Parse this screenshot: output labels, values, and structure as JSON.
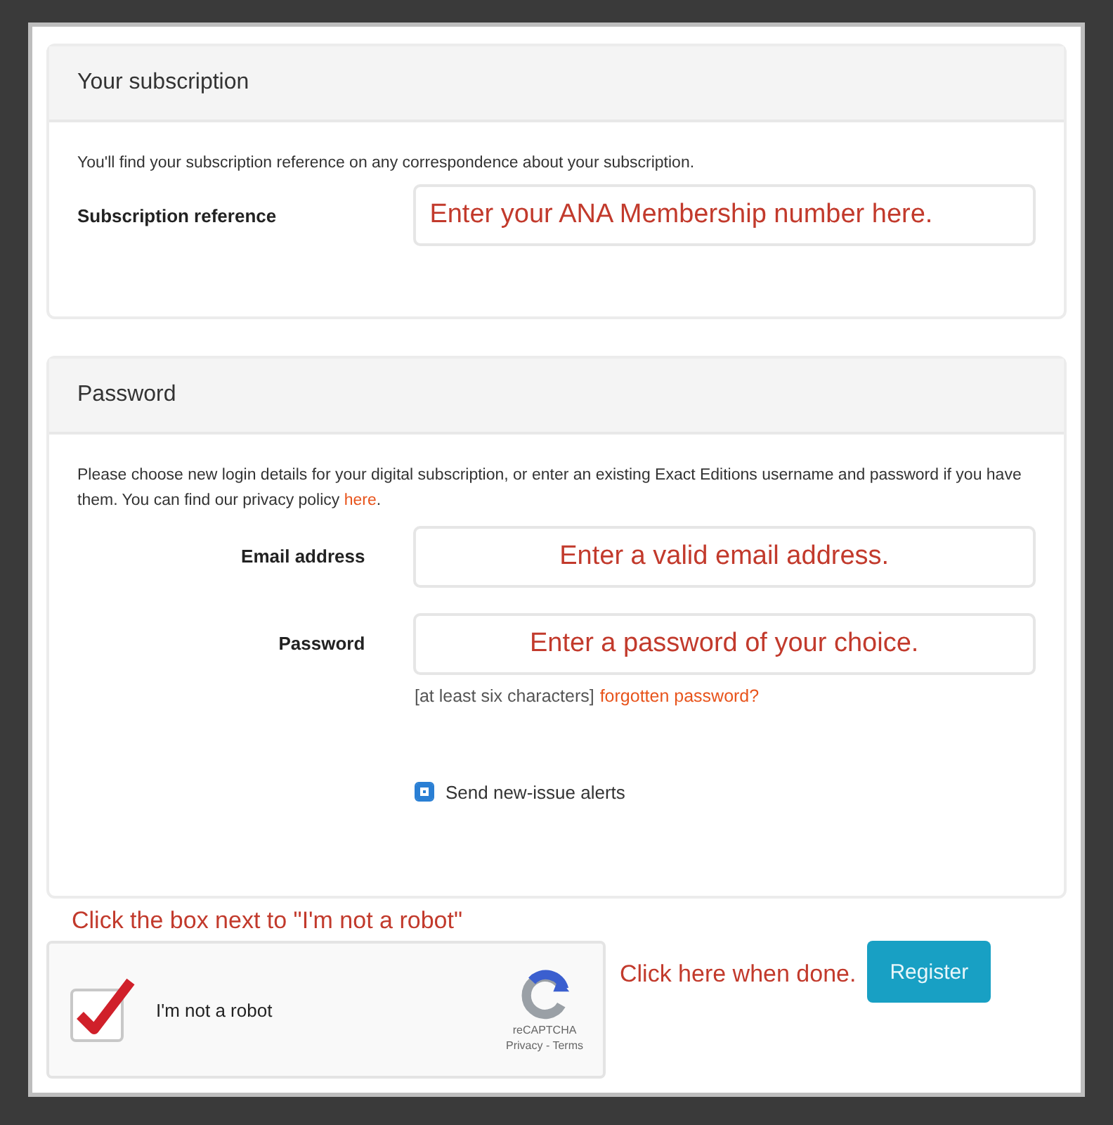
{
  "subscription_panel": {
    "title": "Your subscription",
    "intro": "You'll find your subscription reference on any correspondence about your subscription.",
    "field": {
      "label": "Subscription reference",
      "placeholder": "Enter your ANA Membership number here."
    }
  },
  "password_panel": {
    "title": "Password",
    "intro": "Please choose new login details for your digital subscription, or enter an existing Exact Editions username and password if you have them. You can find our privacy policy ",
    "intro_link": "here",
    "intro_end": ".",
    "fields": [
      {
        "label": "Email address",
        "placeholder": "Enter a valid email address."
      },
      {
        "label": "Password",
        "placeholder": "Enter a password of your choice."
      }
    ],
    "hint": "[at least six characters]",
    "hint_link": "forgotten password?",
    "alerts": {
      "label": "Send new-issue alerts",
      "checked": true
    }
  },
  "captcha_note": "Click the box next to \"I'm not a robot\"",
  "captcha": {
    "label": "I'm not a robot",
    "checked": true,
    "brand": "reCAPTCHA",
    "links": "Privacy - Terms"
  },
  "register_note": "Click here when done.",
  "register_button": "Register"
}
